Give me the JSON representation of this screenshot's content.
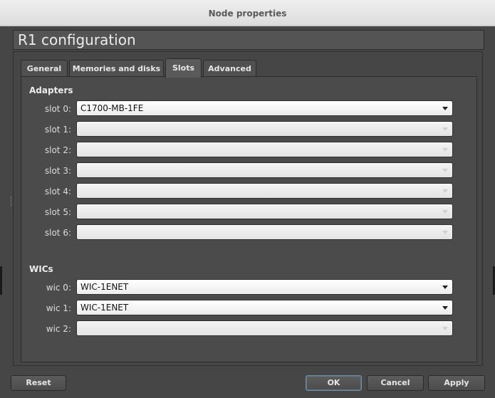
{
  "window": {
    "title": "Node properties"
  },
  "header": {
    "title": "R1 configuration"
  },
  "tabs": [
    {
      "label": "General",
      "active": false
    },
    {
      "label": "Memories and disks",
      "active": false
    },
    {
      "label": "Slots",
      "active": true
    },
    {
      "label": "Advanced",
      "active": false
    }
  ],
  "adapters": {
    "title": "Adapters",
    "slots": [
      {
        "label": "slot 0:",
        "value": "C1700-MB-1FE",
        "enabled": true
      },
      {
        "label": "slot 1:",
        "value": "",
        "enabled": false
      },
      {
        "label": "slot 2:",
        "value": "",
        "enabled": false
      },
      {
        "label": "slot 3:",
        "value": "",
        "enabled": false
      },
      {
        "label": "slot 4:",
        "value": "",
        "enabled": false
      },
      {
        "label": "slot 5:",
        "value": "",
        "enabled": false
      },
      {
        "label": "slot 6:",
        "value": "",
        "enabled": false
      }
    ]
  },
  "wics": {
    "title": "WICs",
    "slots": [
      {
        "label": "wic 0:",
        "value": "WIC-1ENET",
        "enabled": true
      },
      {
        "label": "wic 1:",
        "value": "WIC-1ENET",
        "enabled": true
      },
      {
        "label": "wic 2:",
        "value": "",
        "enabled": false
      }
    ]
  },
  "buttons": {
    "reset": "Reset",
    "ok": "OK",
    "cancel": "Cancel",
    "apply": "Apply"
  },
  "icons": {
    "dropdown": "chevron-down-icon"
  }
}
